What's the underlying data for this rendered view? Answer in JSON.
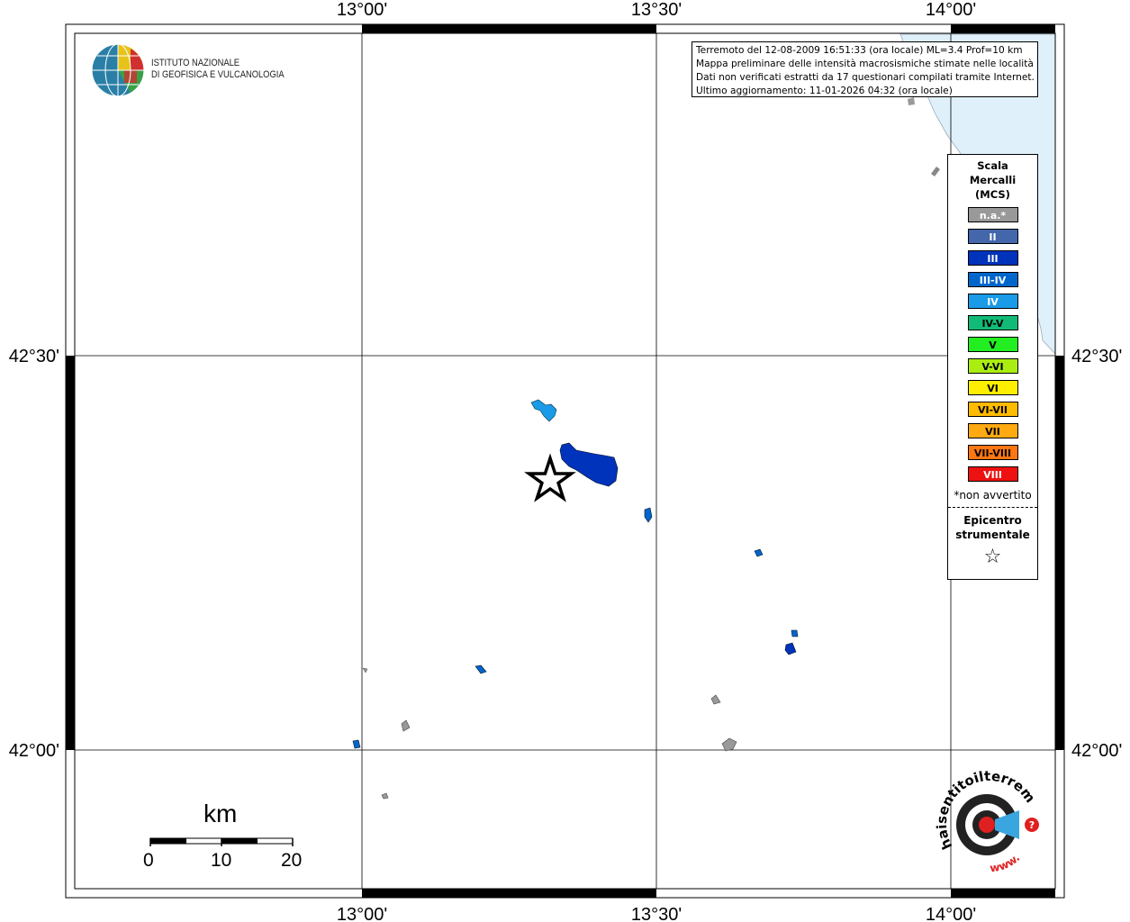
{
  "title_lines": [
    "Terremoto del 12-08-2009 16:51:33 (ora locale) ML=3.4 Prof=10 km",
    "Mappa preliminare delle intensità macrosismiche stimate nelle località",
    "Dati non verificati estratti da 17 questionari compilati tramite Internet.",
    "Ultimo aggiornamento: 11-01-2026 04:32 (ora locale)"
  ],
  "logo": {
    "line1": "ISTITUTO NAZIONALE",
    "line2": "DI GEOFISICA E VULCANOLOGIA"
  },
  "coords": {
    "top": [
      "13°00'",
      "13°30'",
      "14°00'"
    ],
    "bottom": [
      "13°00'",
      "13°30'",
      "14°00'"
    ],
    "left": [
      "42°30'",
      "42°00'"
    ],
    "right": [
      "42°30'",
      "42°00'"
    ]
  },
  "legend": {
    "title": [
      "Scala",
      "Mercalli",
      "(MCS)"
    ],
    "items": [
      {
        "label": "n.a.*",
        "color": "#999999",
        "text_color": "#ffffff"
      },
      {
        "label": "II",
        "color": "#4466aa",
        "text_color": "#ffffff"
      },
      {
        "label": "III",
        "color": "#0033bb",
        "text_color": "#ffffff"
      },
      {
        "label": "III-IV",
        "color": "#0066cc",
        "text_color": "#ffffff"
      },
      {
        "label": "IV",
        "color": "#1a9be8",
        "text_color": "#ffffff"
      },
      {
        "label": "IV-V",
        "color": "#11bb77",
        "text_color": "#000000"
      },
      {
        "label": "V",
        "color": "#22ee22",
        "text_color": "#000000"
      },
      {
        "label": "V-VI",
        "color": "#aaee11",
        "text_color": "#000000"
      },
      {
        "label": "VI",
        "color": "#ffee00",
        "text_color": "#000000"
      },
      {
        "label": "VI-VII",
        "color": "#ffbb00",
        "text_color": "#000000"
      },
      {
        "label": "VII",
        "color": "#ffaa11",
        "text_color": "#000000"
      },
      {
        "label": "VII-VIII",
        "color": "#ff7711",
        "text_color": "#000000"
      },
      {
        "label": "VIII",
        "color": "#ee1111",
        "text_color": "#ffffff"
      }
    ],
    "na_note": "*non avvertito",
    "epicenter_lines": [
      "Epicentro",
      "strumentale"
    ],
    "star_symbol": "☆"
  },
  "scale_bar": {
    "unit": "km",
    "ticks": [
      "0",
      "10",
      "20"
    ]
  },
  "badge": {
    "text_top": "haisentitoilterremoto.it",
    "text_bottom": "www."
  },
  "colors": {
    "sea": "#dff0fb",
    "frame": "#000000",
    "epicenter": "#000000"
  }
}
